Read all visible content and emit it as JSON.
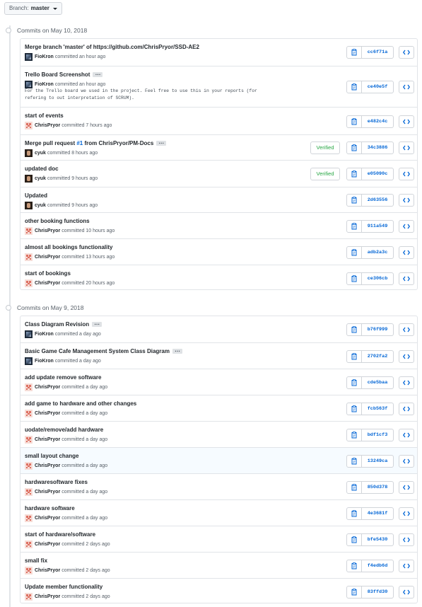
{
  "branch": {
    "label": "Branch:",
    "name": "master"
  },
  "groups": [
    {
      "heading": "Commits on May 10, 2018",
      "commits": [
        {
          "message": "Merge branch 'master' of https://github.com/ChrisPryor/SSD-AE2",
          "author": "FioKron",
          "time": "committed an hour ago",
          "sha": "cc6f71a",
          "avatar": "fio"
        },
        {
          "message": "Trello Board Screenshot",
          "has_more": true,
          "description": "For the Trello board we used in the project. Feel free to use this in your reports (for\nrefering to out interpretation of SCRUM).",
          "author": "FioKron",
          "time": "committed an hour ago",
          "sha": "ce40e5f",
          "avatar": "fio"
        },
        {
          "message": "start of events",
          "author": "ChrisPryor",
          "time": "committed 7 hours ago",
          "sha": "e482c4c",
          "avatar": "chris"
        },
        {
          "message_pre": "Merge pull request ",
          "pr": "#1",
          "message_post": " from ChrisPryor/PM-Docs",
          "has_more": true,
          "author": "cyuk",
          "time": "committed 8 hours ago",
          "sha": "34c3886",
          "avatar": "cyuk",
          "verified": "Verified"
        },
        {
          "message": "updated doc",
          "author": "cyuk",
          "time": "committed 9 hours ago",
          "sha": "e05090c",
          "avatar": "cyuk",
          "verified": "Verified"
        },
        {
          "message": "Updated",
          "author": "cyuk",
          "time": "committed 9 hours ago",
          "sha": "2d63556",
          "avatar": "cyuk"
        },
        {
          "message": "other booking functions",
          "author": "ChrisPryor",
          "time": "committed 10 hours ago",
          "sha": "911a549",
          "avatar": "chris"
        },
        {
          "message": "almost all bookings functionality",
          "author": "ChrisPryor",
          "time": "committed 13 hours ago",
          "sha": "adb2a3c",
          "avatar": "chris"
        },
        {
          "message": "start of bookings",
          "author": "ChrisPryor",
          "time": "committed 20 hours ago",
          "sha": "ce306cb",
          "avatar": "chris"
        }
      ]
    },
    {
      "heading": "Commits on May 9, 2018",
      "commits": [
        {
          "message": "Class Diagram Revision",
          "has_more": true,
          "author": "FioKron",
          "time": "committed a day ago",
          "sha": "b76f999",
          "avatar": "fio"
        },
        {
          "message": "Basic Game Cafe Management System Class Diagram",
          "has_more": true,
          "author": "FioKron",
          "time": "committed a day ago",
          "sha": "2702fa2",
          "avatar": "fio"
        },
        {
          "message": "add update remove software",
          "author": "ChrisPryor",
          "time": "committed a day ago",
          "sha": "cde5baa",
          "avatar": "chris"
        },
        {
          "message": "add game to hardware and other changes",
          "author": "ChrisPryor",
          "time": "committed a day ago",
          "sha": "fcb563f",
          "avatar": "chris"
        },
        {
          "message": "uodate/remove/add hardware",
          "author": "ChrisPryor",
          "time": "committed a day ago",
          "sha": "bdf1cf3",
          "avatar": "chris"
        },
        {
          "message": "small layout change",
          "author": "ChrisPryor",
          "time": "committed a day ago",
          "sha": "13249ca",
          "avatar": "chris",
          "highlight": true
        },
        {
          "message": "hardwaresoftware fixes",
          "author": "ChrisPryor",
          "time": "committed a day ago",
          "sha": "850d378",
          "avatar": "chris"
        },
        {
          "message": "hardware software",
          "author": "ChrisPryor",
          "time": "committed a day ago",
          "sha": "4e3681f",
          "avatar": "chris"
        },
        {
          "message": "start of hardware/software",
          "author": "ChrisPryor",
          "time": "committed 2 days ago",
          "sha": "bfe5430",
          "avatar": "chris"
        },
        {
          "message": "small fix",
          "author": "ChrisPryor",
          "time": "committed 2 days ago",
          "sha": "f4edb6d",
          "avatar": "chris"
        },
        {
          "message": "Update member functionality",
          "author": "ChrisPryor",
          "time": "committed 2 days ago",
          "sha": "83ffd30",
          "avatar": "chris"
        }
      ]
    }
  ],
  "icons": {
    "copy": "clipboard-icon",
    "browse": "code-icon",
    "more": "ellipsis-icon",
    "branch_caret": "triangle-down-icon"
  },
  "colors": {
    "link": "#0366d6",
    "verified": "#28a745",
    "border": "#e1e4e8"
  }
}
